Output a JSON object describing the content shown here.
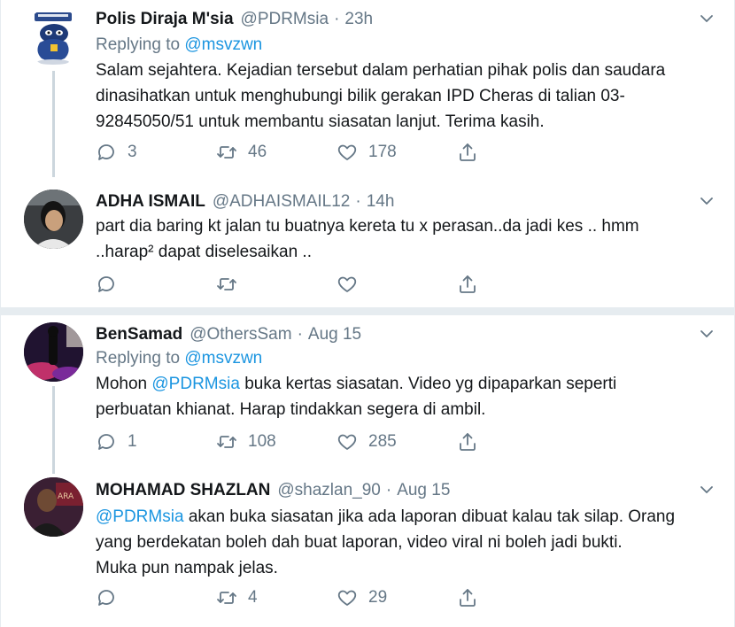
{
  "tweets": [
    {
      "name": "Polis Diraja M'sia",
      "handle": "@PDRMsia",
      "time": "23h",
      "replying_prefix": "Replying to",
      "replying_to": "@msvzwn",
      "text_lines": [
        "Salam sejahtera. Kejadian tersebut dalam perhatian pihak polis dan saudara",
        "dinasihatkan untuk menghubungi bilik gerakan IPD Cheras di talian 03-",
        "92845050/51 untuk membantu siasatan lanjut. Terima kasih."
      ],
      "replies": "3",
      "retweets": "46",
      "likes": "178"
    },
    {
      "name": "ADHA ISMAIL",
      "handle": "@ADHAISMAIL12",
      "time": "14h",
      "text_lines": [
        "part dia baring kt jalan tu buatnya kereta tu x perasan..da jadi kes .. hmm",
        "..harap² dapat diselesaikan .."
      ],
      "replies": "",
      "retweets": "",
      "likes": ""
    },
    {
      "name": "BenSamad",
      "handle": "@OthersSam",
      "time": "Aug 15",
      "replying_prefix": "Replying to",
      "replying_to": "@msvzwn",
      "text_mention": "@PDRMsia",
      "text_line1_before": "Mohon",
      "text_line1_after": "buka kertas siasatan. Video yg dipaparkan seperti",
      "text_line2": "perbuatan khianat. Harap tindakkan segera di ambil.",
      "replies": "1",
      "retweets": "108",
      "likes": "285"
    },
    {
      "name": "MOHAMAD SHAZLAN",
      "handle": "@shazlan_90",
      "time": "Aug 15",
      "text_mention": "@PDRMsia",
      "text_line1_after": "akan buka siasatan jika ada laporan dibuat kalau tak silap. Orang",
      "text_line2": "yang berdekatan boleh dah buat laporan, video viral ni boleh jadi bukti.",
      "text_line3": "Muka pun nampak jelas.",
      "replies": "",
      "retweets": "4",
      "likes": "29"
    }
  ],
  "icons": {
    "reply": "reply-icon",
    "retweet": "retweet-icon",
    "like": "heart-icon",
    "share": "share-icon",
    "caret": "chevron-down-icon"
  },
  "colors": {
    "link": "#1b95e0",
    "secondary": "#657786",
    "text": "#14171a",
    "divider": "#e6ecf0",
    "thread": "#ccd6dd"
  }
}
